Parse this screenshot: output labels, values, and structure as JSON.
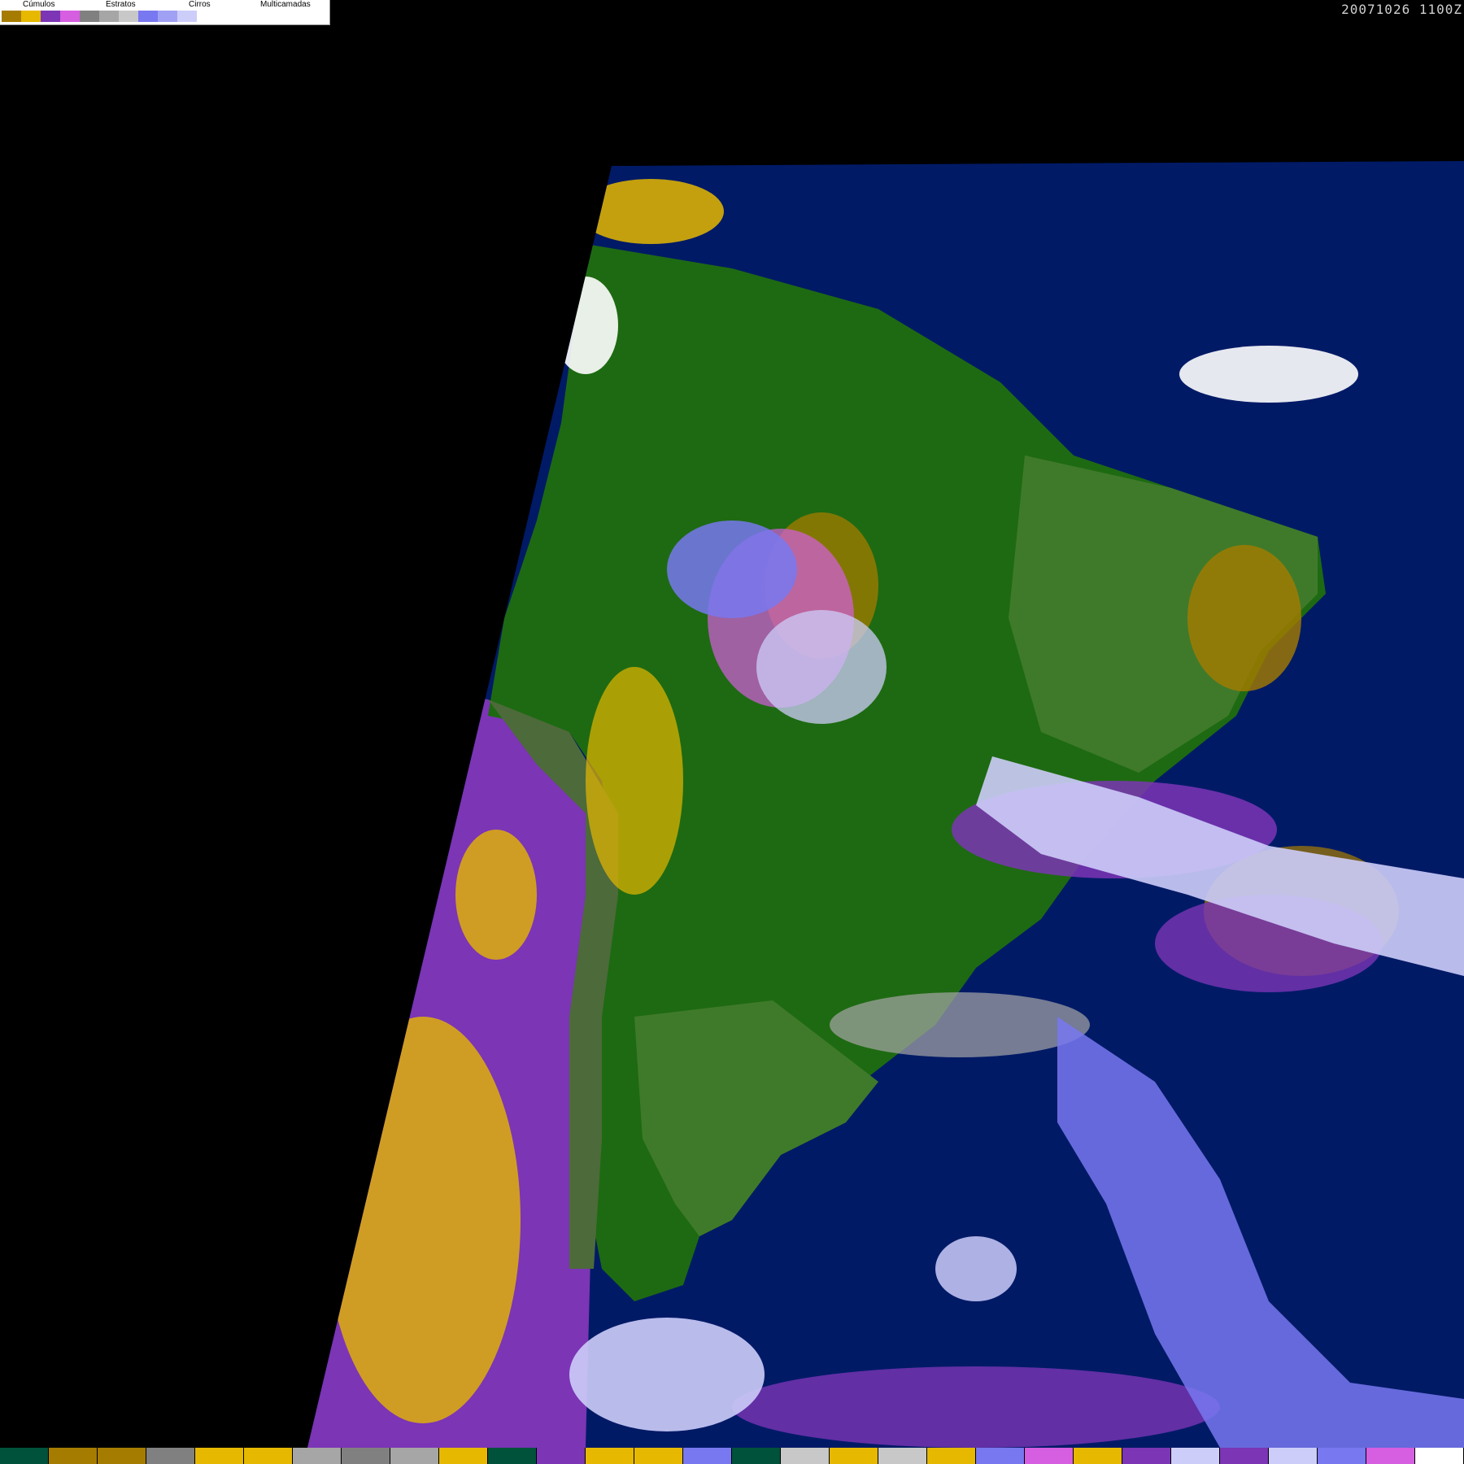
{
  "legend": {
    "groups": [
      {
        "label": "Cúmulos",
        "swatches": [
          "#a67c00",
          "#e6b800"
        ]
      },
      {
        "label": "Estratos",
        "swatches": [
          "#7b35b5",
          "#d65ee0"
        ]
      },
      {
        "label": "Cirros",
        "swatches": [
          "#808080",
          "#a6a6a6",
          "#c8c8c8"
        ]
      },
      {
        "label": "Multicamadas",
        "swatches": [
          "#7878f0",
          "#a0a0f5",
          "#cdcdfa",
          "#ffffff"
        ]
      }
    ]
  },
  "timestamp": "20071026 1100Z",
  "colors": {
    "ocean": "#001a66",
    "land_dark": "#1e6a12",
    "land_light": "#3f7a2a",
    "land_andes": "#4d6a3a",
    "cumulus_dark": "#a67c00",
    "cumulus_light": "#e6b800",
    "stratus_dark": "#7b35b5",
    "stratus_light": "#d65ee0",
    "cirrus_mid": "#a6a6a6",
    "multi_blue": "#7878f0",
    "multi_pale": "#cdcdfa",
    "multi_white": "#ffffff"
  },
  "bottom_strip": [
    "#00523a",
    "#a67c00",
    "#a67c00",
    "#808080",
    "#e6b800",
    "#e6b800",
    "#a6a6a6",
    "#808080",
    "#a6a6a6",
    "#e6b800",
    "#00523a",
    "#7b35b5",
    "#e6b800",
    "#e6b800",
    "#7878f0",
    "#00523a",
    "#c8c8c8",
    "#e6b800",
    "#c8c8c8",
    "#e6b800",
    "#7878f0",
    "#d65ee0",
    "#e6b800",
    "#7b35b5",
    "#cdcdfa",
    "#7b35b5",
    "#cdcdfa",
    "#7878f0",
    "#d65ee0",
    "#ffffff"
  ]
}
